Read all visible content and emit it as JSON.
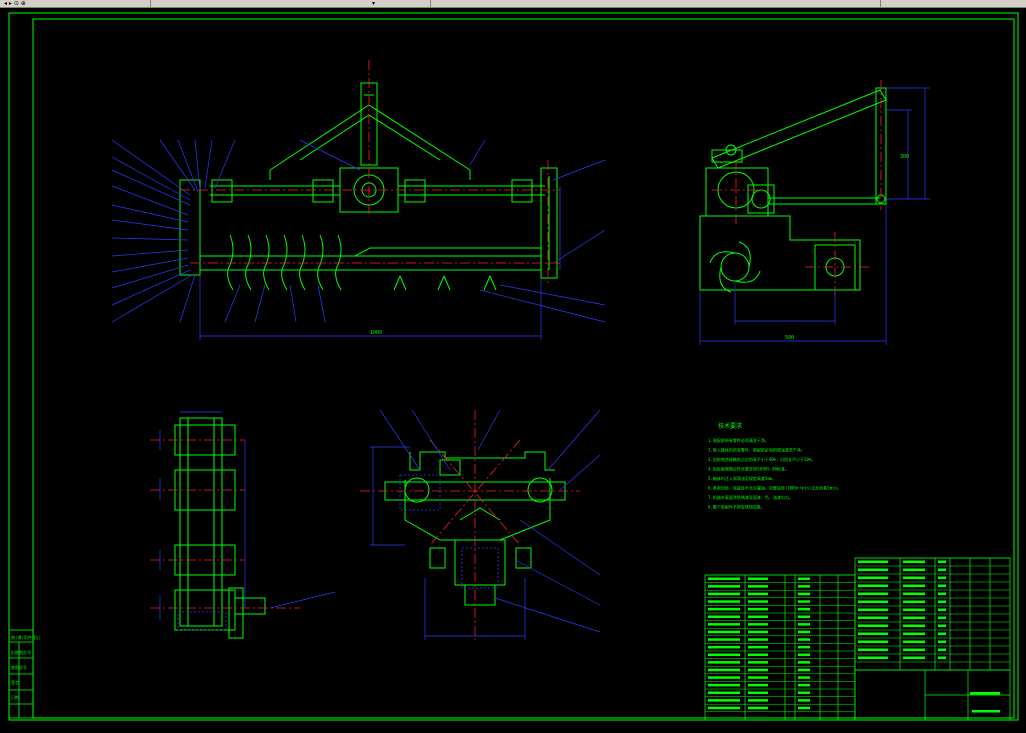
{
  "toolbar": {
    "layer_value": "",
    "color_value": ""
  },
  "colors": {
    "background": "#000000",
    "frame": "#00ff00",
    "part": "#00ff00",
    "dimension": "#2a3cff",
    "centerline": "#ff2020",
    "text": "#00ff00",
    "title_block_fill": "#00ff00"
  },
  "drawing": {
    "tech_requirements_title": "技术要求",
    "tech_requirements": [
      "1.装配前所有零件必须清洗干净。",
      "2.装入箱体的所有零件，装配前必须用煤油清洗干净。",
      "3.齿轮啮合接触斑点沿齿高不小于40%，沿齿长不小于50%。",
      "4.齿轮副侧隙应符合要求GB10095-88标准。",
      "5.箱体内注入润滑油至规定高度5mm。",
      "6.各密封处、连接处不允许漏油，空载运转(1000r/min)正反转各5min。",
      "7.机器外表面涂防锈漆及面漆，色、油漆均匀。",
      "8.整个装配件不得有锈蚀现象。"
    ],
    "front_view": {
      "overall_dimension": "1000"
    },
    "side_view": {
      "overall_dimension": "500",
      "height_dimension": "300"
    },
    "title_block": {
      "revision_labels": [
        "标记",
        "处数",
        "分区",
        "更改文件号",
        "签名"
      ],
      "left_margin_labels": [
        "借(通)用件登记",
        "旧底图总号",
        "底图总号",
        "签字",
        "日期"
      ]
    }
  }
}
